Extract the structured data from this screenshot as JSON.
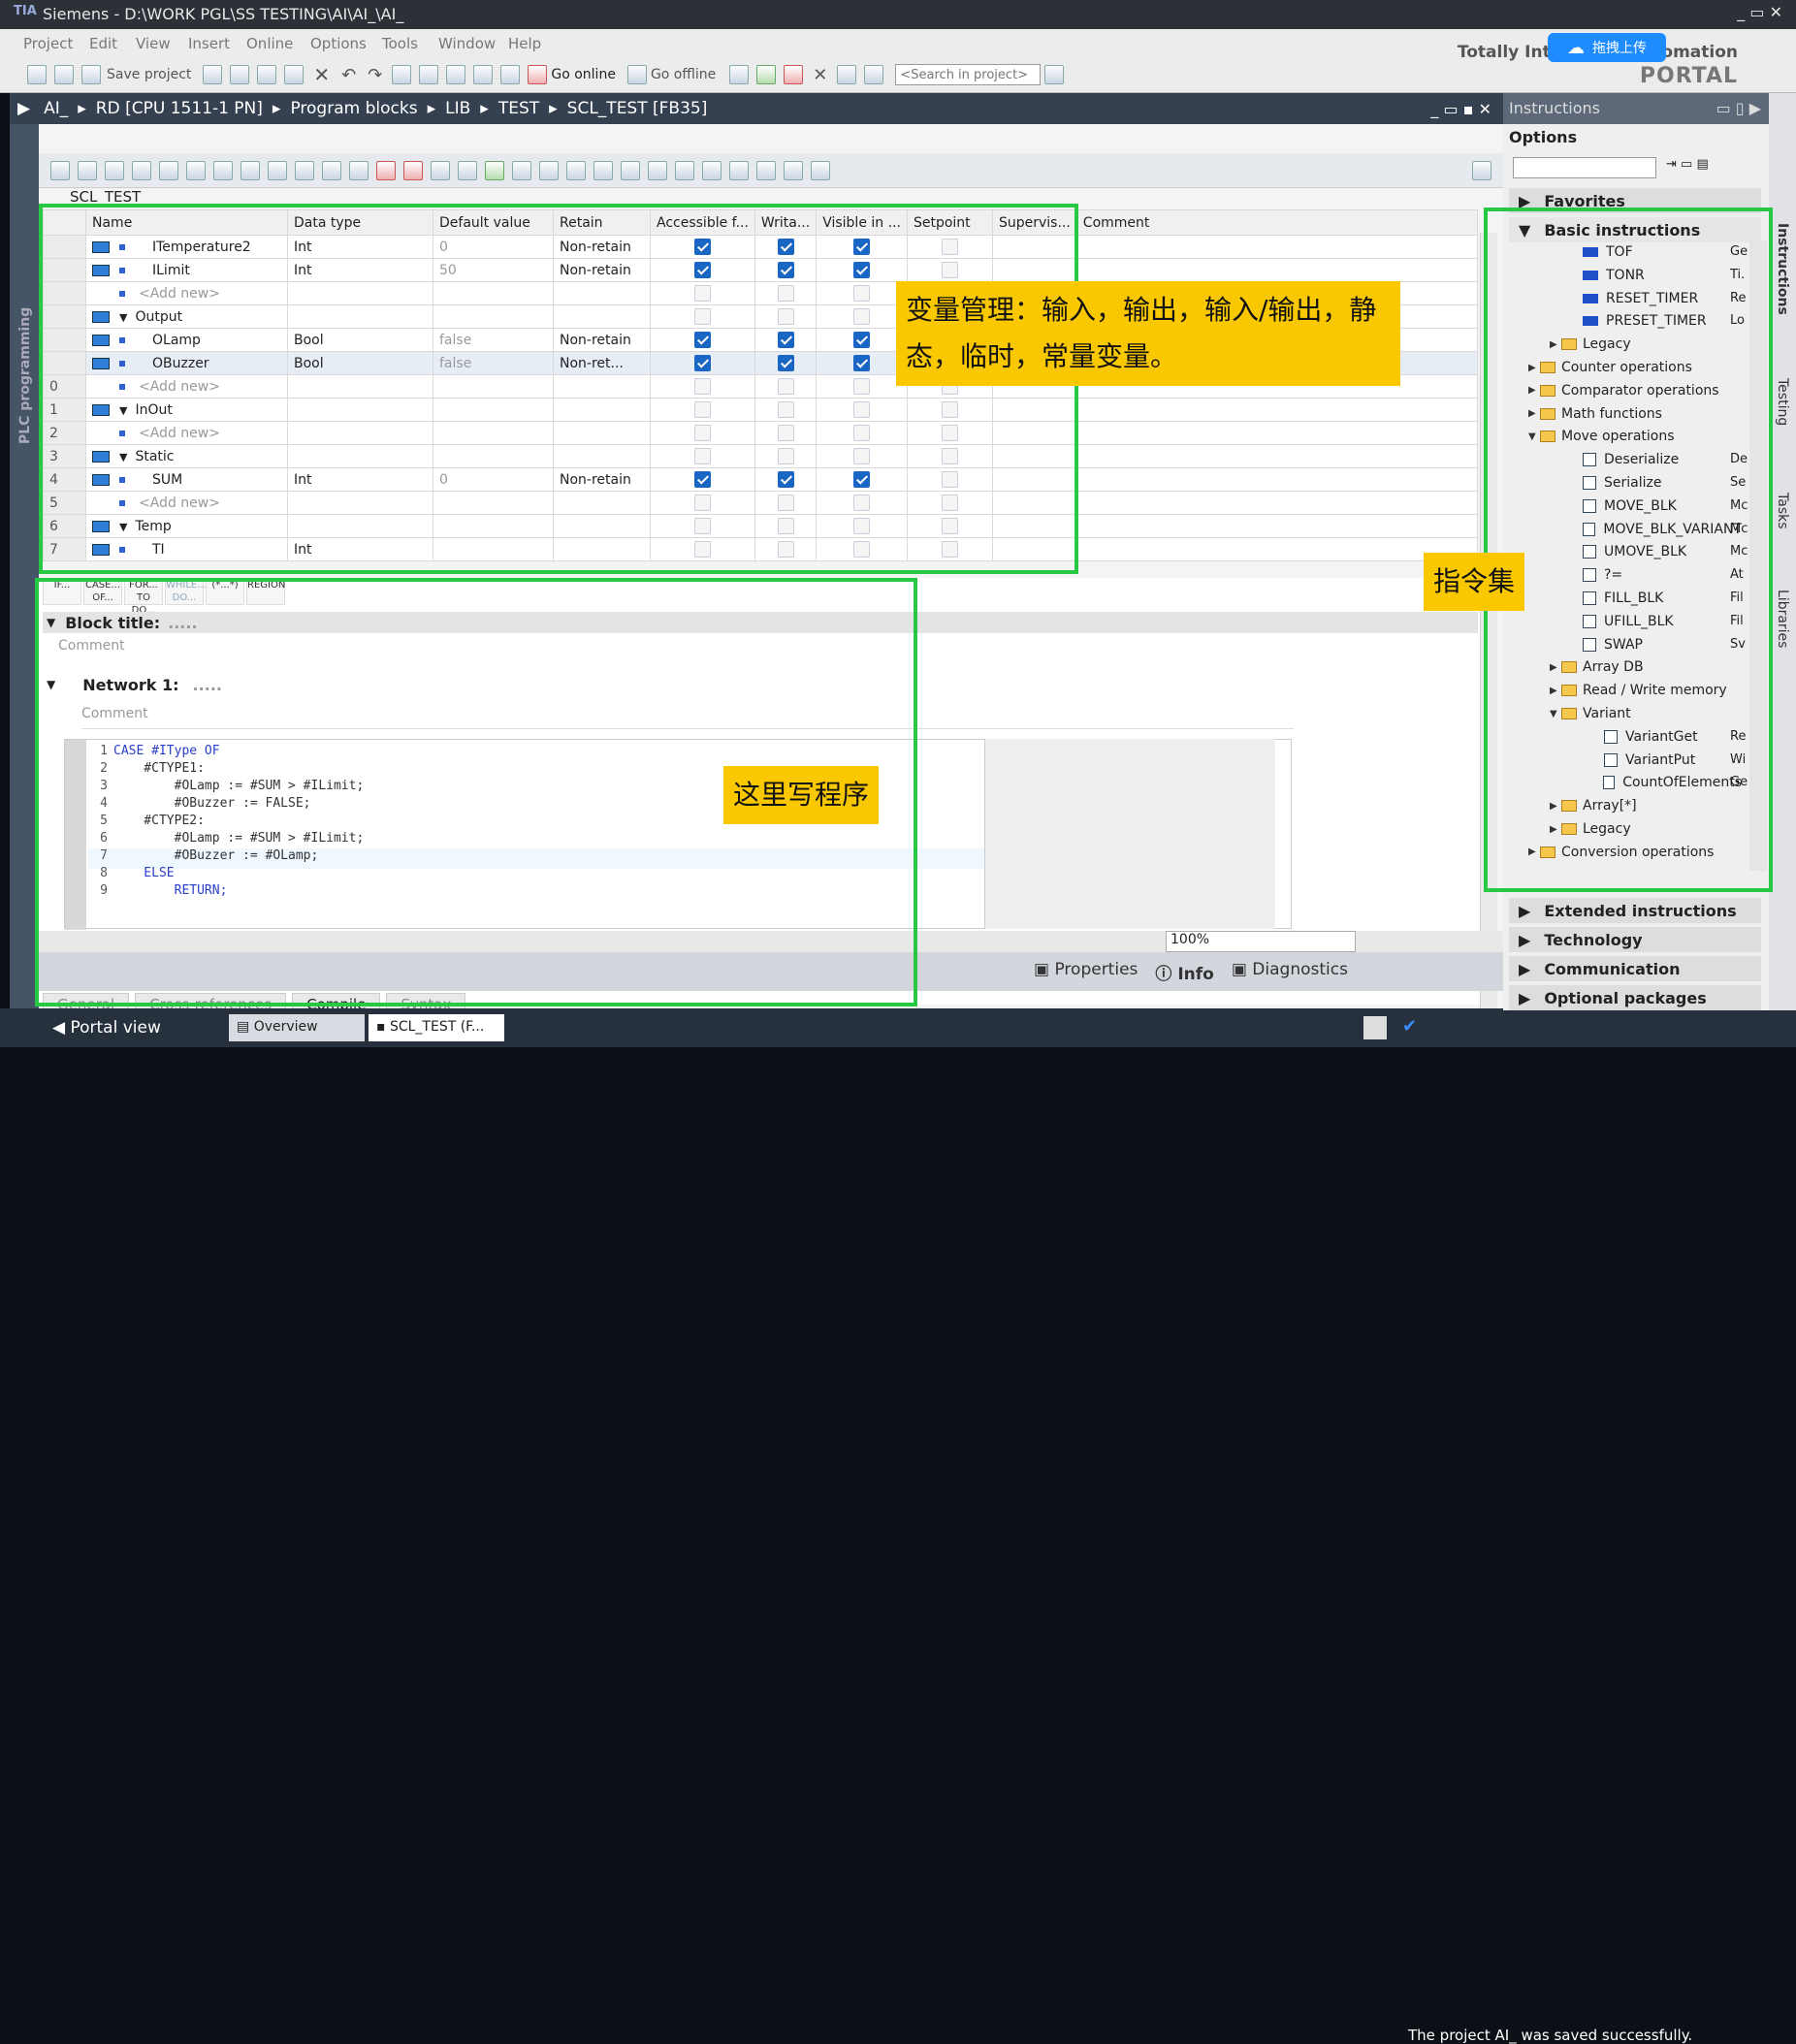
{
  "window": {
    "title": "Siemens  -  D:\\WORK PGL\\SS TESTING\\AI\\AI_\\AI_",
    "logo": "TIA"
  },
  "menu": [
    "Project",
    "Edit",
    "View",
    "Insert",
    "Online",
    "Options",
    "Tools",
    "Window",
    "Help"
  ],
  "toolbar": {
    "save_label": "Save project",
    "go_online": "Go online",
    "go_offline": "Go offline",
    "search_placeholder": "<Search in project>"
  },
  "brand": {
    "line1": "Totally Integrated Automation",
    "line2": "PORTAL",
    "upload_btn": "拖拽上传"
  },
  "breadcrumb": [
    "AI_",
    "RD [CPU 1511-1 PN]",
    "Program blocks",
    "LIB",
    "TEST",
    "SCL_TEST [FB35]"
  ],
  "left_strip": "PLC programming",
  "block_name": "SCL_TEST",
  "table": {
    "headers": [
      "Name",
      "Data type",
      "Default value",
      "Retain",
      "Accessible f...",
      "Writa...",
      "Visible in ...",
      "Setpoint",
      "Supervis...",
      "Comment"
    ],
    "rows": [
      {
        "num": "",
        "name": "ITemperature2",
        "type": "Int",
        "default": "0",
        "retain": "Non-retain",
        "acc": true,
        "wri": true,
        "vis": true,
        "kind": "var"
      },
      {
        "num": "",
        "name": "ILimit",
        "type": "Int",
        "default": "50",
        "retain": "Non-retain",
        "acc": true,
        "wri": true,
        "vis": true,
        "kind": "var"
      },
      {
        "num": "",
        "name": "<Add new>",
        "type": "",
        "default": "",
        "retain": "",
        "kind": "add"
      },
      {
        "num": "",
        "name": "Output",
        "type": "",
        "default": "",
        "retain": "",
        "kind": "section"
      },
      {
        "num": "",
        "name": "OLamp",
        "type": "Bool",
        "default": "false",
        "retain": "Non-retain",
        "acc": true,
        "wri": true,
        "vis": true,
        "kind": "var"
      },
      {
        "num": "",
        "name": "OBuzzer",
        "type": "Bool",
        "default": "false",
        "retain": "Non-ret...",
        "acc": true,
        "wri": true,
        "vis": true,
        "kind": "var"
      },
      {
        "num": "0",
        "name": "<Add new>",
        "type": "",
        "default": "",
        "retain": "",
        "kind": "add"
      },
      {
        "num": "1",
        "name": "InOut",
        "type": "",
        "default": "",
        "retain": "",
        "kind": "section"
      },
      {
        "num": "2",
        "name": "<Add new>",
        "type": "",
        "default": "",
        "retain": "",
        "kind": "add"
      },
      {
        "num": "3",
        "name": "Static",
        "type": "",
        "default": "",
        "retain": "",
        "kind": "section"
      },
      {
        "num": "4",
        "name": "SUM",
        "type": "Int",
        "default": "0",
        "retain": "Non-retain",
        "acc": true,
        "wri": true,
        "vis": true,
        "kind": "var"
      },
      {
        "num": "5",
        "name": "<Add new>",
        "type": "",
        "default": "",
        "retain": "",
        "kind": "add"
      },
      {
        "num": "6",
        "name": "Temp",
        "type": "",
        "default": "",
        "retain": "",
        "kind": "section"
      },
      {
        "num": "7",
        "name": "TI",
        "type": "Int",
        "default": "",
        "retain": "",
        "kind": "var"
      }
    ]
  },
  "keywords": [
    "IF...",
    "CASE... OF...",
    "FOR... TO DO...",
    "WHILE... DO...",
    "(*...*)",
    "REGION"
  ],
  "block_title": "Block title:",
  "block_comment": "Comment",
  "network": "Network 1:",
  "network_comment": "Comment",
  "code": [
    {
      "n": "1",
      "t": "CASE #IType OF"
    },
    {
      "n": "2",
      "t": "    #CTYPE1:"
    },
    {
      "n": "3",
      "t": "        #OLamp := #SUM > #ILimit;"
    },
    {
      "n": "4",
      "t": "        #OBuzzer := FALSE;"
    },
    {
      "n": "5",
      "t": "    #CTYPE2:"
    },
    {
      "n": "6",
      "t": "        #OLamp := #SUM > #ILimit;"
    },
    {
      "n": "7",
      "t": "        #OBuzzer := #OLamp;"
    },
    {
      "n": "8",
      "t": "    ELSE"
    },
    {
      "n": "9",
      "t": "        RETURN;"
    }
  ],
  "zoom": "100%",
  "inspector": {
    "properties": "Properties",
    "info": "Info",
    "diagnostics": "Diagnostics"
  },
  "subtabs": [
    "General",
    "Cross-references",
    "Compile",
    "Syntax"
  ],
  "portal": {
    "view": "Portal view",
    "overview": "Overview",
    "editor_tab": "SCL_TEST (F...",
    "status": "The project AI_ was saved successfully."
  },
  "right": {
    "title": "Instructions",
    "options": "Options",
    "favorites": "Favorites",
    "basic": "Basic instructions",
    "items": [
      {
        "label": "TOF",
        "desc": "Ge",
        "icon": "blue",
        "indent": 2
      },
      {
        "label": "TONR",
        "desc": "Ti.",
        "icon": "blue",
        "indent": 2
      },
      {
        "label": "RESET_TIMER",
        "desc": "Re",
        "icon": "blue",
        "indent": 2
      },
      {
        "label": "PRESET_TIMER",
        "desc": "Lo",
        "icon": "blue",
        "indent": 2
      },
      {
        "label": "Legacy",
        "desc": "",
        "icon": "folder",
        "indent": 1,
        "tri": "▶"
      },
      {
        "label": "Counter operations",
        "desc": "",
        "icon": "folder",
        "indent": 0,
        "tri": "▶"
      },
      {
        "label": "Comparator operations",
        "desc": "",
        "icon": "folder",
        "indent": 0,
        "tri": "▶"
      },
      {
        "label": "Math functions",
        "desc": "",
        "icon": "folder",
        "indent": 0,
        "tri": "▶"
      },
      {
        "label": "Move operations",
        "desc": "",
        "icon": "folder",
        "indent": 0,
        "tri": "▼"
      },
      {
        "label": "Deserialize",
        "desc": "De",
        "icon": "blk",
        "indent": 2
      },
      {
        "label": "Serialize",
        "desc": "Se",
        "icon": "blk",
        "indent": 2
      },
      {
        "label": "MOVE_BLK",
        "desc": "Mc",
        "icon": "blk",
        "indent": 2
      },
      {
        "label": "MOVE_BLK_VARIANT",
        "desc": "Mc",
        "icon": "blk",
        "indent": 2
      },
      {
        "label": "UMOVE_BLK",
        "desc": "Mc",
        "icon": "blk",
        "indent": 2
      },
      {
        "label": "?=",
        "desc": "At",
        "icon": "blk",
        "indent": 2
      },
      {
        "label": "FILL_BLK",
        "desc": "Fil",
        "icon": "blk",
        "indent": 2
      },
      {
        "label": "UFILL_BLK",
        "desc": "Fil",
        "icon": "blk",
        "indent": 2
      },
      {
        "label": "SWAP",
        "desc": "Sv",
        "icon": "blk",
        "indent": 2
      },
      {
        "label": "Array DB",
        "desc": "",
        "icon": "folder",
        "indent": 1,
        "tri": "▶"
      },
      {
        "label": "Read / Write memory",
        "desc": "",
        "icon": "folder",
        "indent": 1,
        "tri": "▶"
      },
      {
        "label": "Variant",
        "desc": "",
        "icon": "folder",
        "indent": 1,
        "tri": "▼"
      },
      {
        "label": "VariantGet",
        "desc": "Re",
        "icon": "blk",
        "indent": 3
      },
      {
        "label": "VariantPut",
        "desc": "Wi",
        "icon": "blk",
        "indent": 3
      },
      {
        "label": "CountOfElements",
        "desc": "Ge",
        "icon": "blk",
        "indent": 3
      },
      {
        "label": "Array[*]",
        "desc": "",
        "icon": "folder",
        "indent": 1,
        "tri": "▶"
      },
      {
        "label": "Legacy",
        "desc": "",
        "icon": "folder",
        "indent": 1,
        "tri": "▶"
      },
      {
        "label": "Conversion operations",
        "desc": "",
        "icon": "folder",
        "indent": 0,
        "tri": "▶"
      }
    ],
    "sections": [
      "Extended instructions",
      "Technology",
      "Communication",
      "Optional packages"
    ],
    "vtabs": [
      "Instructions",
      "Testing",
      "Tasks",
      "Libraries"
    ]
  },
  "annotations": {
    "vars": "变量管理：输入，输出，输入/输出，静态，临时，常量变量。",
    "instr": "指令集",
    "code": "这里写程序"
  }
}
